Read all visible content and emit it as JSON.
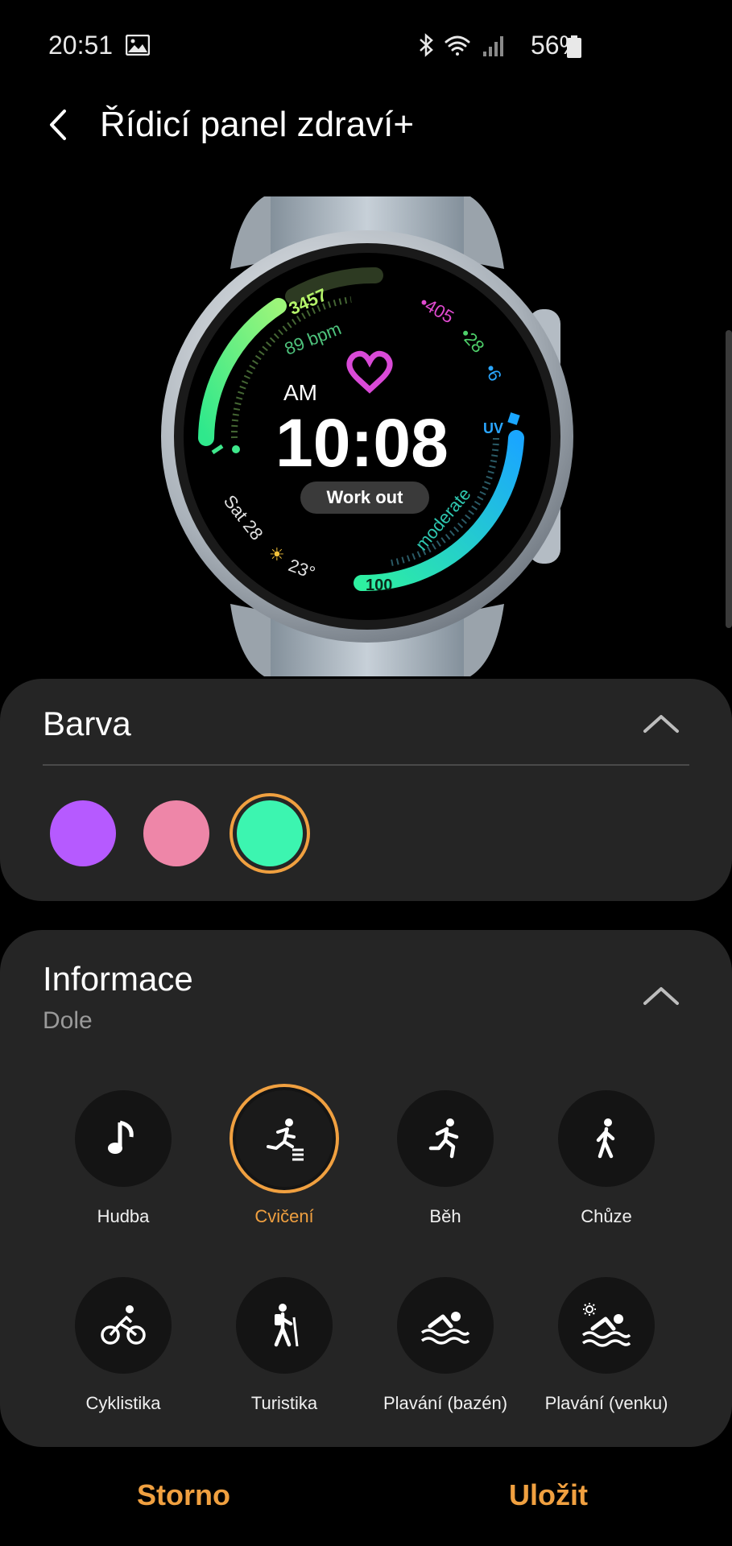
{
  "status_bar": {
    "time": "20:51",
    "battery": "56%"
  },
  "header": {
    "title": "Řídicí panel zdraví+"
  },
  "watch_face": {
    "steps": "3457",
    "heart_rate": "89 bpm",
    "right_values": [
      "•405",
      "•28",
      "•6"
    ],
    "ampm": "AM",
    "time": "10:08",
    "workout": "Work out",
    "date": "Sat 28",
    "temperature": "23°",
    "uv_label": "UV",
    "uv_level": "moderate",
    "bottom_value": "100"
  },
  "color_section": {
    "title": "Barva",
    "swatches": [
      "#b65aff",
      "#ee86a8",
      "#3cf5b0"
    ],
    "selected_index": 2
  },
  "info_section": {
    "title": "Informace",
    "subtitle": "Dole",
    "items": [
      {
        "label": "Hudba",
        "icon": "music-note-icon"
      },
      {
        "label": "Cvičení",
        "icon": "workout-icon"
      },
      {
        "label": "Běh",
        "icon": "running-icon"
      },
      {
        "label": "Chůze",
        "icon": "walking-icon"
      },
      {
        "label": "Cyklistika",
        "icon": "cycling-icon"
      },
      {
        "label": "Turistika",
        "icon": "hiking-icon"
      },
      {
        "label": "Plavání (bazén)",
        "icon": "swimming-pool-icon"
      },
      {
        "label": "Plavání (venku)",
        "icon": "swimming-outdoor-icon"
      }
    ],
    "selected_index": 1
  },
  "footer": {
    "cancel": "Storno",
    "save": "Uložit"
  },
  "colors": {
    "accent": "#f0a040",
    "card_bg": "#252525",
    "item_bg": "#141414"
  }
}
